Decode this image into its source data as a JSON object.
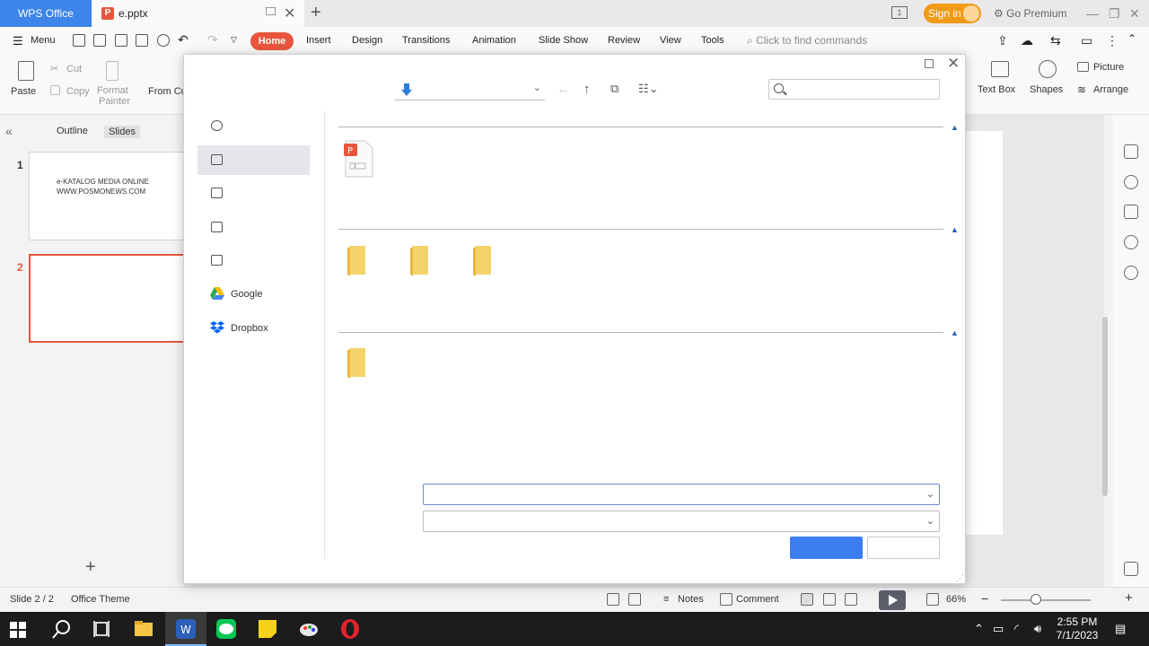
{
  "tabs": {
    "app_tab": "WPS Office",
    "doc_tab": "e.pptx",
    "doc_icon_letter": "P"
  },
  "titlebar": {
    "kbd_badge": "1",
    "signin": "Sign in",
    "premium": "Go Premium"
  },
  "menu": {
    "menu_label": "Menu",
    "items": [
      "Home",
      "Insert",
      "Design",
      "Transitions",
      "Animation",
      "Slide Show",
      "Review",
      "View",
      "Tools"
    ],
    "find_placeholder": "Click to find commands"
  },
  "ribbon": {
    "paste": "Paste",
    "cut": "Cut",
    "copy": "Copy",
    "format_painter_1": "Format",
    "format_painter_2": "Painter",
    "from_cu": "From Cu",
    "text_box": "Text Box",
    "shapes": "Shapes",
    "picture": "Picture",
    "arrange": "Arrange"
  },
  "slides_pane": {
    "outline_tab": "Outline",
    "slides_tab": "Slides",
    "slides": [
      {
        "number": "1",
        "line1": "e-KATALOG MEDIA ONLINE",
        "line2": "WWW.POSMONEWS.COM"
      },
      {
        "number": "2",
        "line1": "",
        "line2": ""
      }
    ]
  },
  "dialog": {
    "sidebar": {
      "google": "Google",
      "dropbox": "Dropbox"
    },
    "path_value": "",
    "search_placeholder": "",
    "filename_value": "",
    "filetype_value": "",
    "ok_label": "",
    "cancel_label": ""
  },
  "statusbar": {
    "slide_info": "Slide 2 / 2",
    "theme": "Office Theme",
    "notes": "Notes",
    "comment": "Comment",
    "zoom": "66%"
  },
  "taskbar": {
    "time": "2:55 PM",
    "date": "7/1/2023"
  },
  "colors": {
    "accent_orange": "#e8553c",
    "wps_blue": "#3d85e8",
    "primary_button": "#3c7ef0",
    "signin_orange": "#f19a16",
    "folder_yellow": "#f5d36b"
  }
}
